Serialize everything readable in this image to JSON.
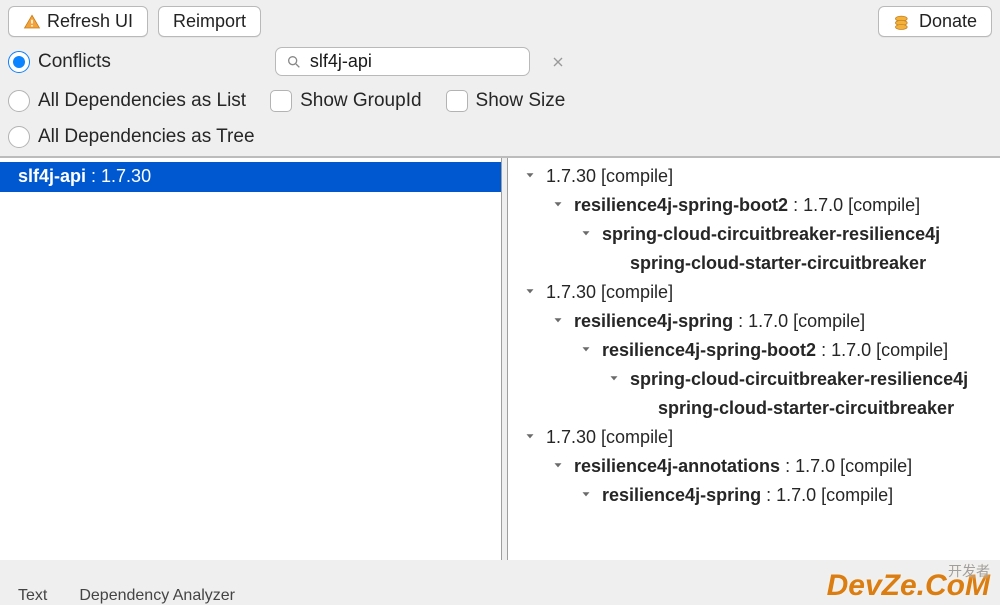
{
  "toolbar": {
    "refresh_label": "Refresh UI",
    "reimport_label": "Reimport",
    "donate_label": "Donate"
  },
  "filter": {
    "radios": [
      {
        "label": "Conflicts",
        "selected": true
      },
      {
        "label": "All Dependencies as List",
        "selected": false
      },
      {
        "label": "All Dependencies as Tree",
        "selected": false
      }
    ],
    "search_value": "slf4j-api",
    "checks": [
      {
        "label": "Show GroupId",
        "checked": false
      },
      {
        "label": "Show Size",
        "checked": false
      }
    ]
  },
  "left_list": [
    {
      "name": "slf4j-api",
      "version": "1.7.30",
      "selected": true
    }
  ],
  "right_tree": [
    {
      "indent": 0,
      "expand": "down",
      "text": "1.7.30 [compile]"
    },
    {
      "indent": 1,
      "expand": "down",
      "bold_prefix": "resilience4j-spring-boot2",
      "suffix": " : 1.7.0 [compile]"
    },
    {
      "indent": 2,
      "expand": "down",
      "bold_prefix": "spring-cloud-circuitbreaker-resilience4j",
      "suffix": ""
    },
    {
      "indent": 3,
      "expand": "none",
      "bold_prefix": "spring-cloud-starter-circuitbreaker",
      "suffix": ""
    },
    {
      "indent": 0,
      "expand": "down",
      "text": "1.7.30 [compile]"
    },
    {
      "indent": 1,
      "expand": "down",
      "bold_prefix": "resilience4j-spring",
      "suffix": " : 1.7.0 [compile]"
    },
    {
      "indent": 2,
      "expand": "down",
      "bold_prefix": "resilience4j-spring-boot2",
      "suffix": " : 1.7.0 [compile]"
    },
    {
      "indent": 3,
      "expand": "down",
      "bold_prefix": "spring-cloud-circuitbreaker-resilience4j",
      "suffix": ""
    },
    {
      "indent": 4,
      "expand": "none",
      "bold_prefix": "spring-cloud-starter-circuitbreaker",
      "suffix": ""
    },
    {
      "indent": 0,
      "expand": "down",
      "text": "1.7.30 [compile]"
    },
    {
      "indent": 1,
      "expand": "down",
      "bold_prefix": "resilience4j-annotations",
      "suffix": " : 1.7.0 [compile]"
    },
    {
      "indent": 2,
      "expand": "down",
      "bold_prefix": "resilience4j-spring",
      "suffix": " : 1.7.0 [compile]"
    }
  ],
  "bottom_tabs": {
    "text_tab": "Text",
    "analyzer_tab": "Dependency Analyzer"
  },
  "watermark": {
    "main": "DevZe.CoM",
    "sub": "开发者"
  }
}
